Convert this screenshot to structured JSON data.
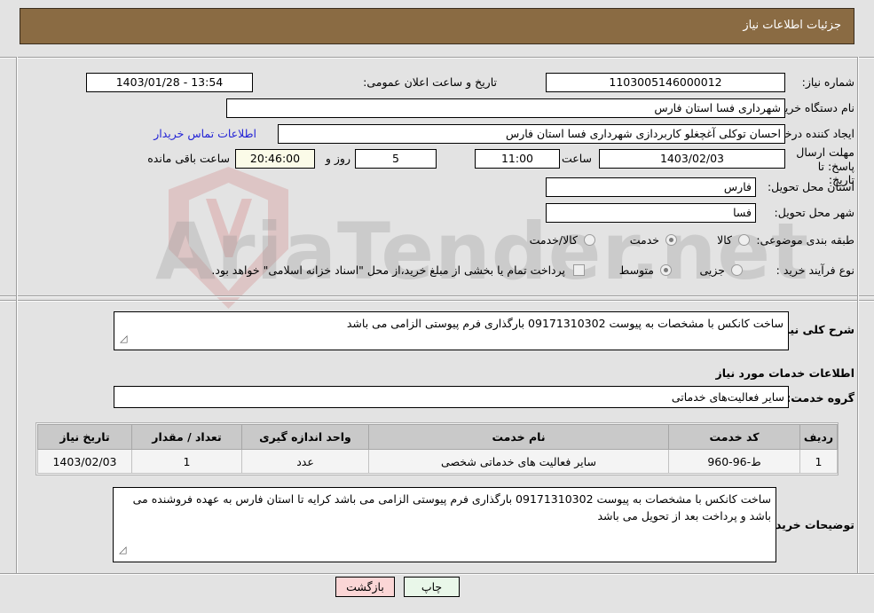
{
  "header": {
    "title": "جزئیات اطلاعات نیاز"
  },
  "form": {
    "need_number_label": "شماره نیاز:",
    "need_number_value": "1103005146000012",
    "announce_datetime_label": "تاریخ و ساعت اعلان عمومی:",
    "announce_datetime_value": "13:54 - 1403/01/28",
    "buyer_org_label": "نام دستگاه خریدار:",
    "buyer_org_value": "شهرداری فسا استان فارس",
    "requester_label": "ایجاد کننده درخواست:",
    "requester_value": "احسان توکلی آغچغلو کاربردازی شهرداری فسا استان فارس",
    "buyer_contact_link": "اطلاعات تماس خریدار",
    "deadline_label": "مهلت ارسال پاسخ: تا تاریخ:",
    "deadline_date_value": "1403/02/03",
    "time_label": "ساعت",
    "deadline_time_value": "11:00",
    "days_remaining_value": "5",
    "days_label": "روز و",
    "countdown_value": "20:46:00",
    "remaining_label": "ساعت باقی مانده",
    "province_label": "استان محل تحویل:",
    "province_value": "فارس",
    "city_label": "شهر محل تحویل:",
    "city_value": "فسا",
    "category_label": "طبقه بندی موضوعی:",
    "category_options": [
      "کالا",
      "خدمت",
      "کالا/خدمت"
    ],
    "category_selected": "خدمت",
    "process_type_label": "نوع فرآیند خرید :",
    "process_options": [
      "جزیی",
      "متوسط"
    ],
    "process_selected": "متوسط",
    "treasury_checkbox_label": "پرداخت تمام یا بخشی از مبلغ خرید،از محل \"اسناد خزانه اسلامی\" خواهد بود.",
    "treasury_checked": false
  },
  "need_summary": {
    "label": "شرح کلی نیاز:",
    "value": "ساخت کانکس با مشخصات به پیوست 09171310302 بارگذاری فرم پیوستی الزامی می باشد"
  },
  "services_section": {
    "heading": "اطلاعات خدمات مورد نیاز",
    "service_group_label": "گروه خدمت:",
    "service_group_value": "سایر فعالیت‌های خدماتی"
  },
  "table": {
    "headers": [
      "ردیف",
      "کد خدمت",
      "نام خدمت",
      "واحد اندازه گیری",
      "تعداد / مقدار",
      "تاریخ نیاز"
    ],
    "rows": [
      {
        "row": "1",
        "code": "ط-96-960",
        "name": "سایر فعالیت های خدماتی شخصی",
        "unit": "عدد",
        "qty": "1",
        "date": "1403/02/03"
      }
    ]
  },
  "buyer_notes": {
    "label": "توضیحات خریدار:",
    "value": "ساخت کانکس با مشخصات به پیوست 09171310302 بارگذاری فرم پیوستی الزامی می باشد کرایه تا استان فارس به عهده فروشنده می باشد و پرداخت بعد از تحویل می باشد"
  },
  "footer": {
    "print_label": "چاپ",
    "back_label": "بازگشت"
  },
  "watermark": {
    "text": "AriaTender.net"
  },
  "colors": {
    "header_bg": "#8a6b43",
    "page_bg": "#e3e3e3",
    "link": "#2323d6",
    "print_btn": "#e9f7e9",
    "back_btn": "#fbd6d6",
    "countdown_bg": "#fbfbe8",
    "table_header_bg": "#c9c9c9"
  }
}
